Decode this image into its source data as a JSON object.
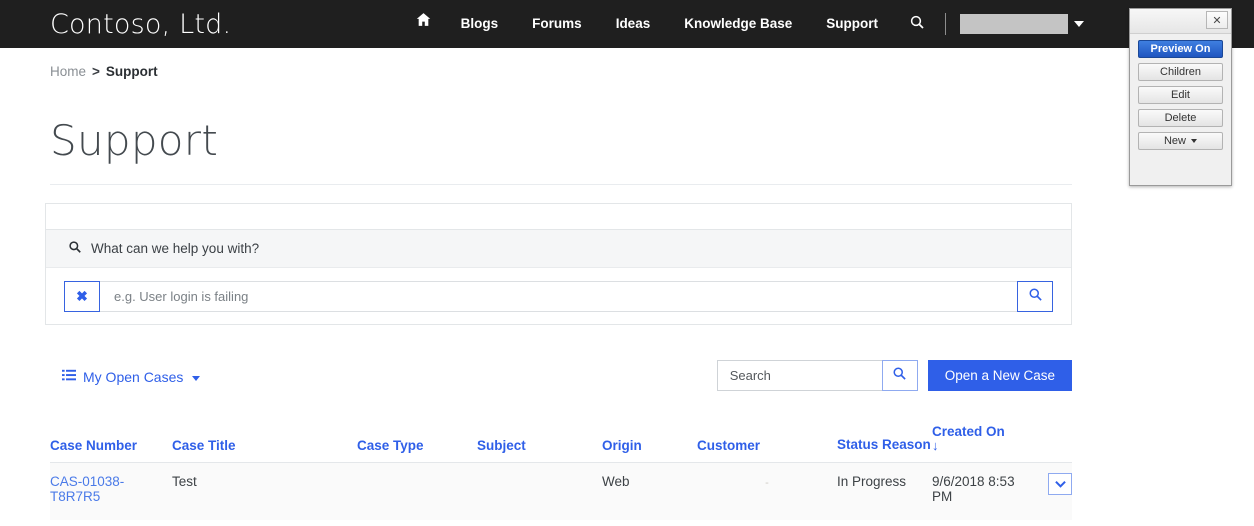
{
  "topnav": {
    "brand": "Contoso, Ltd.",
    "home_icon": "home-icon",
    "links": [
      {
        "label": "Blogs"
      },
      {
        "label": "Forums"
      },
      {
        "label": "Ideas"
      },
      {
        "label": "Knowledge Base"
      },
      {
        "label": "Support"
      }
    ],
    "search_icon": "search-icon",
    "user_menu_value": "",
    "background": "#1f1f1f"
  },
  "breadcrumb": {
    "home": "Home",
    "separator": ">",
    "current": "Support"
  },
  "page": {
    "title": "Support"
  },
  "kb_search": {
    "prompt": "What can we help you with?",
    "prompt_icon": "search-icon",
    "clear_label": "✖",
    "input_value": "",
    "input_placeholder": "e.g. User login is failing",
    "submit_icon": "search-icon"
  },
  "toolbar": {
    "view_icon": "list-icon",
    "view_label": "My Open Cases",
    "search_value": "",
    "search_placeholder": "Search",
    "search_button_icon": "search-icon",
    "new_case_label": "Open a New Case",
    "accent_color": "#2f5fe8"
  },
  "table": {
    "columns": [
      {
        "label": "Case Number",
        "sort": ""
      },
      {
        "label": "Case Title",
        "sort": ""
      },
      {
        "label": "Case Type",
        "sort": ""
      },
      {
        "label": "Subject",
        "sort": ""
      },
      {
        "label": "Origin",
        "sort": ""
      },
      {
        "label": "Customer",
        "sort": ""
      },
      {
        "label": "Status Reason",
        "sort": ""
      },
      {
        "label": "Created On",
        "sort": "↓"
      }
    ],
    "rows": [
      {
        "case_number": "CAS-01038-T8R7R5",
        "case_title": "Test",
        "case_type": "",
        "subject": "",
        "origin": "Web",
        "customer": "-",
        "status_reason": "In Progress",
        "created_on": "9/6/2018 8:53 PM",
        "row_menu_icon": "chevron-down-icon"
      }
    ]
  },
  "edit_panel": {
    "close_label": "✕",
    "buttons": [
      {
        "label": "Preview On",
        "primary": true
      },
      {
        "label": "Children",
        "primary": false
      },
      {
        "label": "Edit",
        "primary": false
      },
      {
        "label": "Delete",
        "primary": false
      },
      {
        "label": "New",
        "primary": false,
        "caret": true
      }
    ]
  }
}
